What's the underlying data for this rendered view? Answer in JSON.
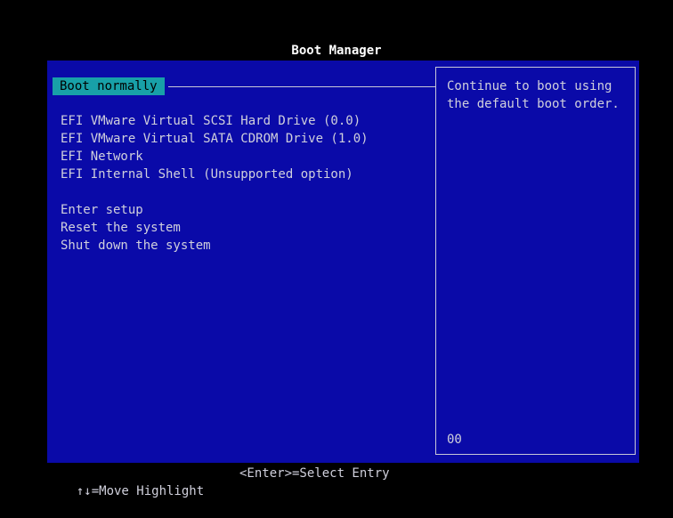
{
  "title": "Boot Manager",
  "menu": {
    "selected_label": "Boot normally",
    "group1": [
      "EFI VMware Virtual SCSI Hard Drive (0.0)",
      "EFI VMware Virtual SATA CDROM Drive (1.0)",
      "EFI Network",
      "EFI Internal Shell (Unsupported option)"
    ],
    "group2": [
      "Enter setup",
      "Reset the system",
      "Shut down the system"
    ]
  },
  "help": {
    "text": "Continue to boot using the default boot order.",
    "code": "00"
  },
  "status": {
    "move_hint": "↑↓=Move Highlight",
    "select_hint": "<Enter>=Select Entry"
  },
  "colors": {
    "background": "#000000",
    "panel": "#0a0aa8",
    "highlight": "#18a0a8",
    "title": "#ffffff"
  }
}
